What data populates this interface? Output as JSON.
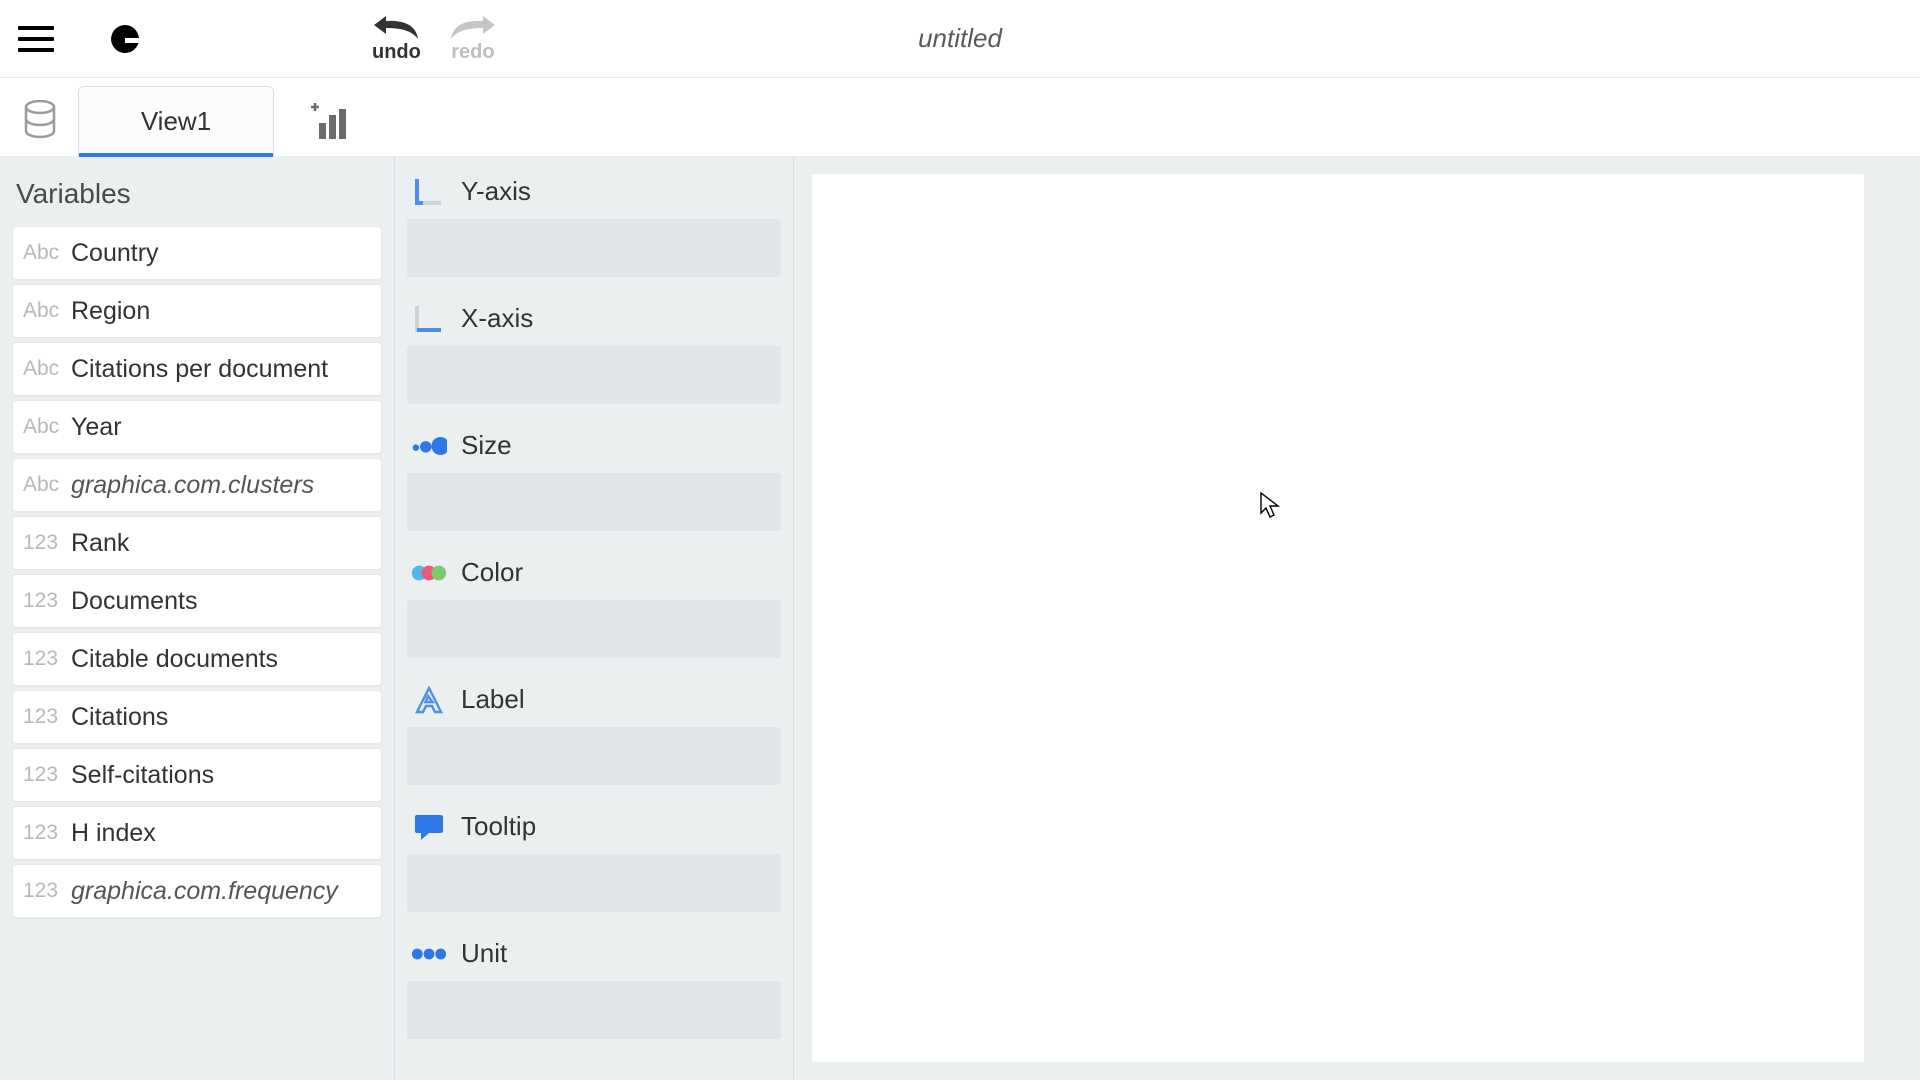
{
  "toolbar": {
    "undo_label": "undo",
    "redo_label": "redo",
    "title": "untitled"
  },
  "tabs": {
    "active": "View1"
  },
  "variables_panel": {
    "title": "Variables",
    "items": [
      {
        "type": "Abc",
        "name": "Country",
        "italic": false
      },
      {
        "type": "Abc",
        "name": "Region",
        "italic": false
      },
      {
        "type": "Abc",
        "name": "Citations per document",
        "italic": false
      },
      {
        "type": "Abc",
        "name": "Year",
        "italic": false
      },
      {
        "type": "Abc",
        "name": "graphica.com.clusters",
        "italic": true
      },
      {
        "type": "123",
        "name": "Rank",
        "italic": false
      },
      {
        "type": "123",
        "name": "Documents",
        "italic": false
      },
      {
        "type": "123",
        "name": "Citable documents",
        "italic": false
      },
      {
        "type": "123",
        "name": "Citations",
        "italic": false
      },
      {
        "type": "123",
        "name": "Self-citations",
        "italic": false
      },
      {
        "type": "123",
        "name": "H index",
        "italic": false
      },
      {
        "type": "123",
        "name": "graphica.com.frequency",
        "italic": true
      }
    ]
  },
  "shelves": [
    {
      "key": "yaxis",
      "label": "Y-axis",
      "icon": "yaxis"
    },
    {
      "key": "xaxis",
      "label": "X-axis",
      "icon": "xaxis"
    },
    {
      "key": "size",
      "label": "Size",
      "icon": "size"
    },
    {
      "key": "color",
      "label": "Color",
      "icon": "color"
    },
    {
      "key": "label",
      "label": "Label",
      "icon": "label"
    },
    {
      "key": "tooltip",
      "label": "Tooltip",
      "icon": "tooltip"
    },
    {
      "key": "unit",
      "label": "Unit",
      "icon": "unit"
    }
  ]
}
